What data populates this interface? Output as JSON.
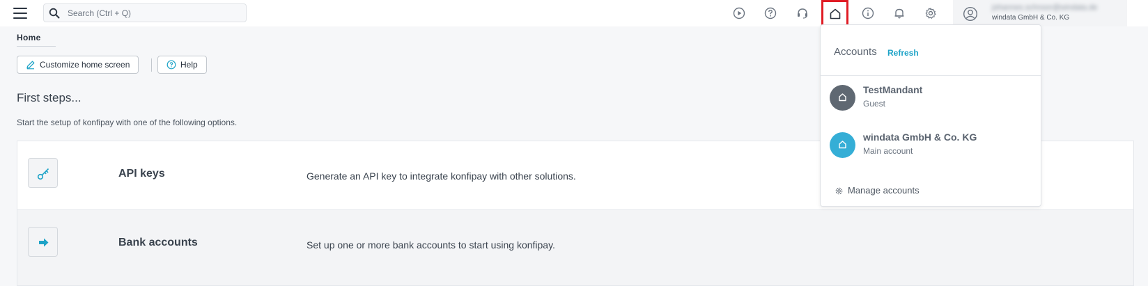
{
  "topbar": {
    "search_placeholder": "Search (Ctrl + Q)",
    "user_email": "johannes.schnoor@windata.de",
    "user_company": "windata GmbH & Co. KG"
  },
  "breadcrumb": "Home",
  "toolbar": {
    "customize_label": "Customize home screen",
    "help_label": "Help"
  },
  "main": {
    "heading": "First steps...",
    "subtitle": "Start the setup of konfipay with one of the following options.",
    "cards": [
      {
        "title": "API keys",
        "description": "Generate an API key to integrate konfipay with other solutions.",
        "icon": "key-icon"
      },
      {
        "title": "Bank accounts",
        "description": "Set up one or more bank accounts to start using konfipay.",
        "icon": "arrow-right-icon"
      }
    ]
  },
  "accounts_menu": {
    "title": "Accounts",
    "refresh_label": "Refresh",
    "accounts": [
      {
        "name": "TestMandant",
        "role": "Guest",
        "color": "#5f6872"
      },
      {
        "name": "windata GmbH & Co. KG",
        "role": "Main account",
        "color": "#35aed6"
      }
    ],
    "manage_label": "Manage accounts"
  },
  "colors": {
    "accent": "#1ea3c7",
    "highlight_border": "#e01b24"
  }
}
